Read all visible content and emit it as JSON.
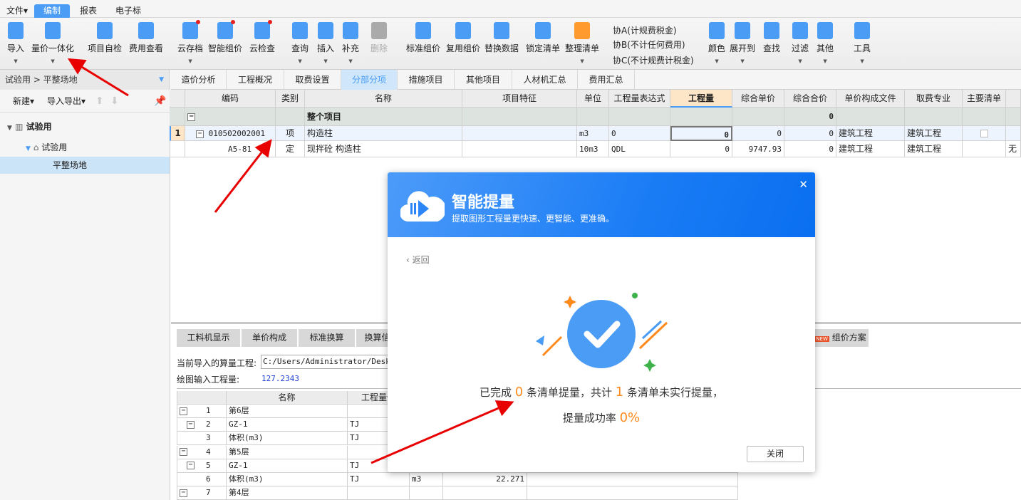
{
  "menu": {
    "items": [
      "文件▾",
      "编制",
      "报表",
      "电子标"
    ],
    "active": "编制"
  },
  "ribbon": {
    "buttons": [
      {
        "label": "导入",
        "icon": "import-icon"
      },
      {
        "label": "量价一体化",
        "icon": "quantity-price-icon"
      },
      {
        "label": "项目自检",
        "icon": "self-check-icon"
      },
      {
        "label": "费用查看",
        "icon": "cost-view-icon"
      },
      {
        "label": "云存档",
        "icon": "cloud-save-icon"
      },
      {
        "label": "智能组价",
        "icon": "smart-pricing-icon"
      },
      {
        "label": "云检查",
        "icon": "cloud-check-icon"
      },
      {
        "label": "查询",
        "icon": "query-icon"
      },
      {
        "label": "插入",
        "icon": "insert-icon"
      },
      {
        "label": "补充",
        "icon": "supplement-icon"
      },
      {
        "label": "删除",
        "icon": "trash-icon"
      },
      {
        "label": "标准组价",
        "icon": "standard-pricing-icon"
      },
      {
        "label": "复用组价",
        "icon": "reuse-pricing-icon"
      },
      {
        "label": "替换数据",
        "icon": "replace-data-icon"
      },
      {
        "label": "锁定清单",
        "icon": "lock-icon"
      },
      {
        "label": "整理清单",
        "icon": "organize-list-icon"
      },
      {
        "label": "颜色",
        "icon": "color-bucket-icon"
      },
      {
        "label": "展开到",
        "icon": "expand-icon"
      },
      {
        "label": "查找",
        "icon": "binoculars-icon"
      },
      {
        "label": "过滤",
        "icon": "filter-icon"
      },
      {
        "label": "其他",
        "icon": "grid-icon"
      },
      {
        "label": "工具",
        "icon": "tools-icon"
      }
    ],
    "xie": [
      "协A(计规费税金)",
      "协B(不计任何费用)",
      "协C(不计规费计税金)"
    ]
  },
  "left": {
    "breadcrumb": "试验用 > 平整场地",
    "new": "新建▾",
    "import_export": "导入导出▾",
    "tree": [
      "试验用",
      "试验用",
      "平整场地"
    ]
  },
  "tabs": [
    "造价分析",
    "工程概况",
    "取费设置",
    "分部分项",
    "措施项目",
    "其他项目",
    "人材机汇总",
    "费用汇总"
  ],
  "grid": {
    "headers": [
      "",
      "编码",
      "类别",
      "名称",
      "项目特征",
      "单位",
      "工程量表达式",
      "工程量",
      "综合单价",
      "综合合价",
      "单价构成文件",
      "取费专业",
      "主要清单",
      ""
    ],
    "rows": [
      [
        "",
        "",
        "",
        "整个项目",
        "",
        "",
        "",
        "",
        "",
        "0",
        "",
        "",
        "",
        ""
      ],
      [
        "1",
        "010502002001",
        "项",
        "构造柱",
        "",
        "m3",
        "0",
        "0",
        "0",
        "0",
        "建筑工程",
        "建筑工程",
        "",
        ""
      ],
      [
        "",
        "A5-81",
        "定",
        "现拌砼 构造柱",
        "",
        "10m3",
        "QDL",
        "0",
        "9747.93",
        "0",
        "建筑工程",
        "建筑工程",
        "",
        "无"
      ]
    ]
  },
  "bottom": {
    "tabs": [
      "工料机显示",
      "单价构成",
      "标准换算",
      "换算信"
    ],
    "right_tab": "组价方案",
    "new_badge": "NEW",
    "import_label": "当前导入的算量工程:",
    "import_path": "C:/Users/Administrator/Desktop",
    "draw_label": "绘图输入工程量:",
    "draw_value": "127.2343",
    "headers": [
      "",
      "名称",
      "工程量代"
    ],
    "rows": [
      [
        "1",
        "第6层",
        "",
        "",
        ""
      ],
      [
        "2",
        "GZ-1",
        "TJ",
        "",
        ""
      ],
      [
        "3",
        "体积(m3)",
        "TJ",
        "",
        ""
      ],
      [
        "4",
        "第5层",
        "",
        "",
        ""
      ],
      [
        "5",
        "GZ-1",
        "TJ",
        "",
        ""
      ],
      [
        "6",
        "体积(m3)",
        "TJ",
        "m3",
        "22.271"
      ],
      [
        "7",
        "第4层",
        "",
        "",
        ""
      ]
    ]
  },
  "dialog": {
    "title": "智能提量",
    "subtitle": "提取图形工程量更快速、更智能、更准确。",
    "back": "返回",
    "msg1a": "已完成",
    "done": "0",
    "msg1b": "条清单提量，共计",
    "total": "1",
    "msg1c": "条清单未实行提量，",
    "msg2": "提量成功率",
    "rate": "0%",
    "close": "关闭"
  },
  "colors": {
    "accent": "#4a9cf5",
    "orange": "#ff8a1e",
    "dialog_header": "#1a7cf5"
  }
}
